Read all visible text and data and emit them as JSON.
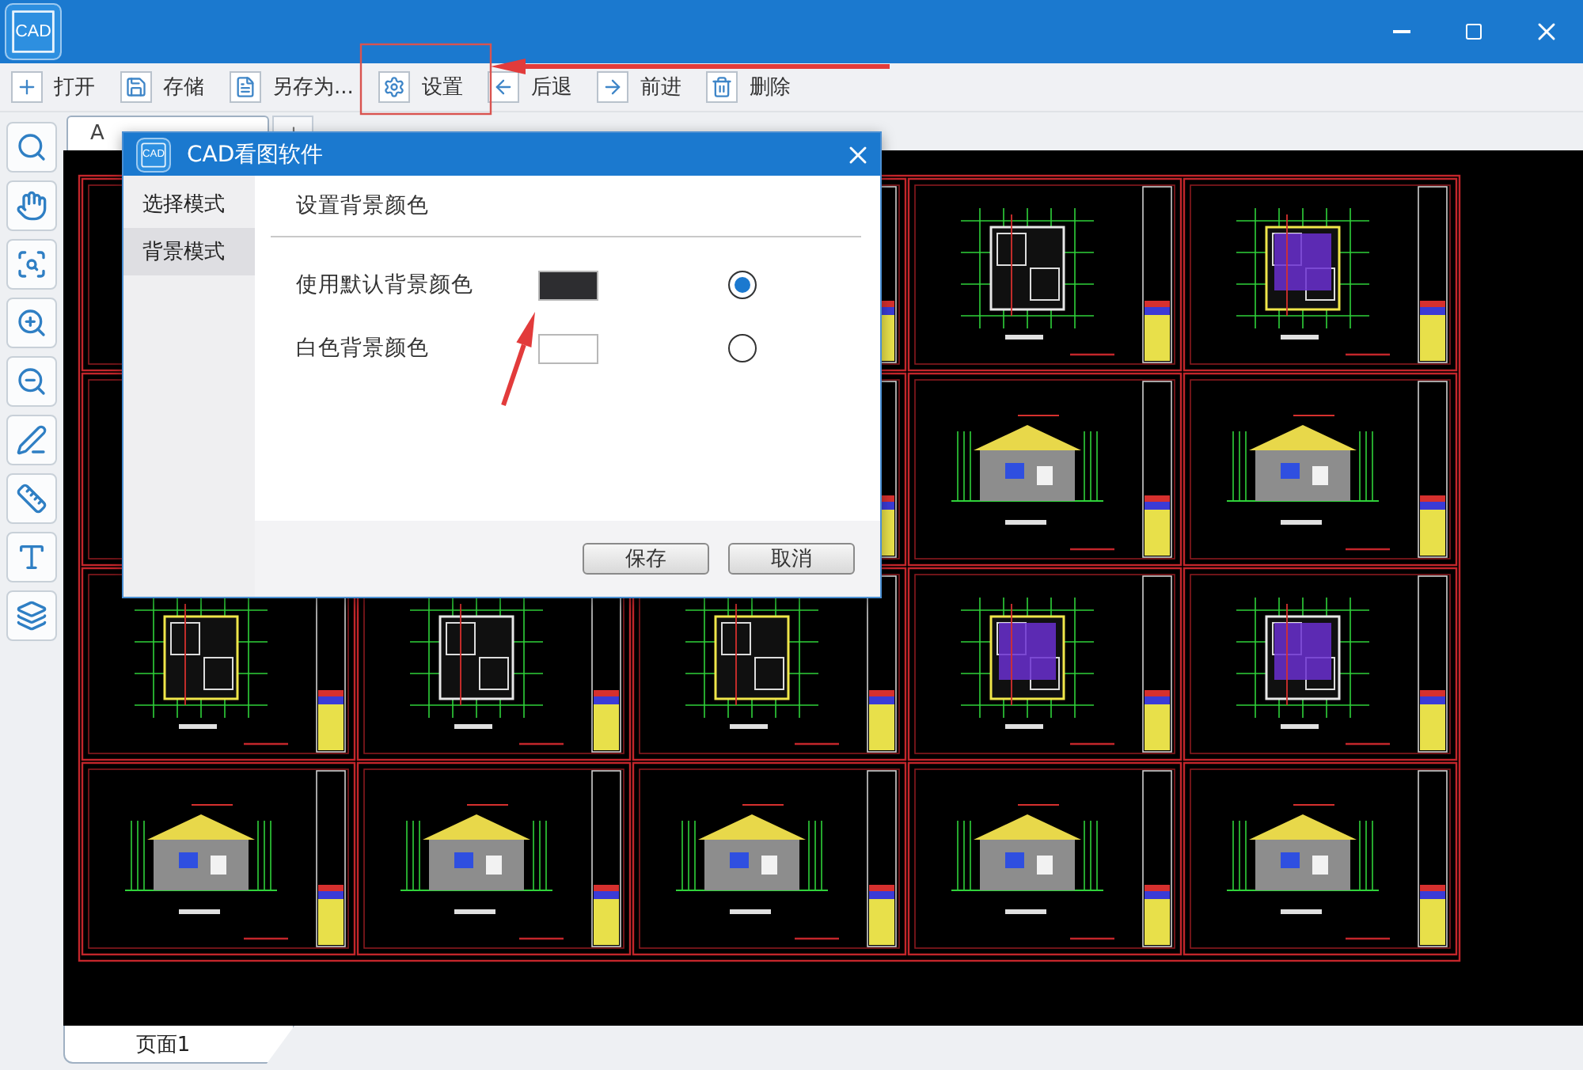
{
  "app": {
    "logo": "CAD"
  },
  "toolbar": [
    {
      "kind": "open",
      "label": "打开"
    },
    {
      "kind": "save",
      "label": "存储"
    },
    {
      "kind": "save-as",
      "label": "另存为..."
    },
    {
      "kind": "settings",
      "label": "设置"
    },
    {
      "kind": "back",
      "label": "后退"
    },
    {
      "kind": "forward",
      "label": "前进"
    },
    {
      "kind": "delete",
      "label": "删除"
    }
  ],
  "tabs": [
    {
      "label": "A",
      "selected": true
    }
  ],
  "tool_rail": [
    {
      "kind": "zoom-back"
    },
    {
      "kind": "pan"
    },
    {
      "kind": "zoom-window"
    },
    {
      "kind": "zoom-in"
    },
    {
      "kind": "zoom-out"
    },
    {
      "kind": "markup"
    },
    {
      "kind": "measure"
    },
    {
      "kind": "text"
    },
    {
      "kind": "layers"
    }
  ],
  "dialog": {
    "logo": "CAD",
    "title": "CAD看图软件",
    "nav": [
      {
        "label": "选择模式",
        "selected": false
      },
      {
        "label": "背景模式",
        "selected": true
      }
    ],
    "heading": "设置背景颜色",
    "options": [
      {
        "label": "使用默认背景颜色",
        "color": "#2d2d30",
        "selected": true
      },
      {
        "label": "白色背景颜色",
        "color": "#ffffff",
        "selected": false
      }
    ],
    "buttons": [
      "保存",
      "取消"
    ]
  },
  "page_tabs": [
    {
      "label": "页面1",
      "selected": true
    }
  ],
  "annotations": [
    {
      "kind": "frame"
    },
    {
      "kind": "arrow"
    },
    {
      "kind": "arrow"
    }
  ]
}
